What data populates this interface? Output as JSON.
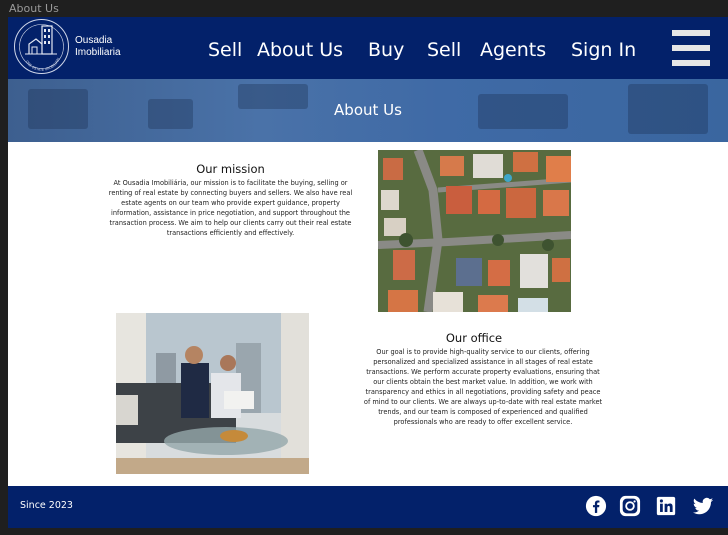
{
  "tab": {
    "label": "About Us"
  },
  "header": {
    "brand_line1": "Ousadia",
    "brand_line2": "Imobiliaria",
    "logo_ring_text": "ONE ESTATE IMOBILIÁRIA",
    "nav": [
      "Sell",
      "About Us",
      "Buy",
      "Sell",
      "Agents",
      "Sign In"
    ]
  },
  "hero": {
    "title": "About Us"
  },
  "mission": {
    "title": "Our mission",
    "text": "At Ousadia Imobiliária, our mission is to facilitate the buying, selling or renting of real estate by connecting buyers and sellers. We also have real estate agents on our team who provide expert guidance, property information, assistance in price negotiation, and support throughout the transaction process. We aim to help our clients carry out their real estate transactions efficiently and effectively."
  },
  "office": {
    "title": "Our office",
    "text": "Our goal is to provide high-quality service to our clients, offering personalized and specialized assistance in all stages of real estate transactions. We perform accurate property evaluations, ensuring that our clients obtain the best market value. In addition, we work with transparency and ethics in all negotiations, providing safety and peace of mind to our clients. We are always up-to-date with real estate market trends, and our team is composed of experienced and qualified professionals who are ready to offer excellent service."
  },
  "footer": {
    "since": "Since 2023",
    "social_icons": [
      "facebook-icon",
      "instagram-icon",
      "linkedin-icon",
      "twitter-icon"
    ]
  },
  "colors": {
    "navy": "#03216a",
    "white": "#ffffff",
    "hero": "#4a72a8"
  }
}
